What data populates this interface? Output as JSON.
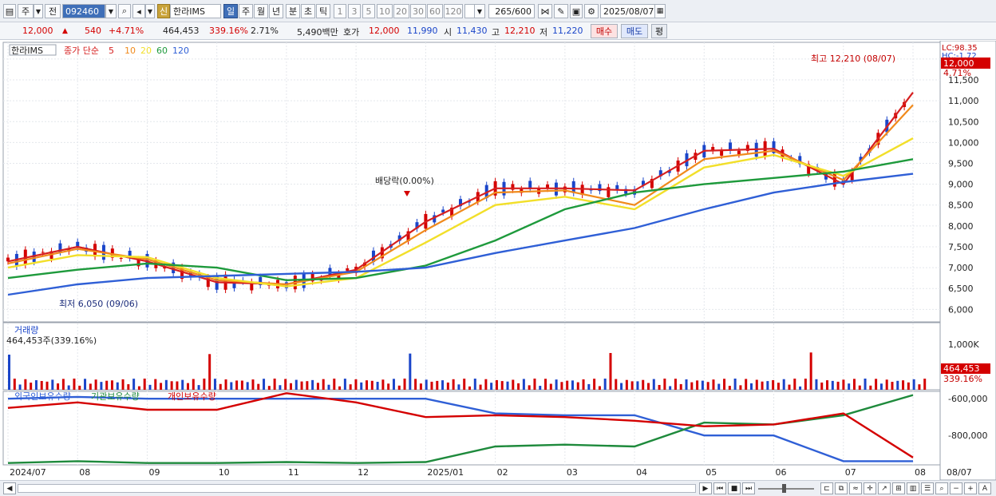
{
  "toolbar": {
    "period_label": "주",
    "prev_label": "전",
    "stock_code": "092460",
    "new_badge": "신",
    "stock_name": "한라IMS",
    "period_buttons": [
      "일",
      "주",
      "월",
      "년",
      "분",
      "초",
      "틱"
    ],
    "interval_buttons": [
      "1",
      "3",
      "5",
      "10",
      "20",
      "30",
      "60",
      "120"
    ],
    "count_value": "265",
    "count_total": "/600",
    "date_value": "2025/08/07"
  },
  "info": {
    "price": "12,000",
    "change": "540",
    "change_pct": "+4.71%",
    "volume": "464,453",
    "volume_ratio": "339.16%",
    "turnover": "2.71%",
    "amount": "5,490백만",
    "quote_label": "호가",
    "ask": "12,000",
    "bid": "11,990",
    "open_label": "시",
    "open": "11,430",
    "high_label": "고",
    "high": "12,210",
    "low_label": "저",
    "low": "11,220",
    "buy_label": "매수",
    "sell_label": "매도",
    "eval_label": "평"
  },
  "legend": {
    "name": "한라IMS",
    "ma_label": "종가 단순",
    "ma_periods": [
      "5",
      "10",
      "20",
      "60",
      "120"
    ]
  },
  "annotations": {
    "high": "최고 12,210 (08/07)",
    "low": "최저 6,050 (09/06)",
    "dividend": "배당락(0.00%)",
    "lc": "LC:98.35",
    "hc": "HC:-1.72",
    "price_tag": "12,000",
    "pct_tag": "4.71%"
  },
  "volume_panel": {
    "title": "거래량",
    "value_text": "464,453주(339.16%)",
    "axis_label": "1,000K",
    "tag_value": "464,453",
    "tag_pct": "339.16%"
  },
  "holding_panel": {
    "legend": [
      "외국인보유수량",
      "기관보유수량",
      "개인보유수량"
    ],
    "axis_labels": [
      "-600,000",
      "-800,000"
    ]
  },
  "colors": {
    "ma5": "#d61f1f",
    "ma10": "#f08a1c",
    "ma20": "#f2df2a",
    "ma60": "#1e9a3c",
    "ma120": "#2f5fd6",
    "up": "#d40000",
    "down": "#1a45c9"
  },
  "chart_data": {
    "type": "line",
    "title": "한라IMS",
    "x": [
      "2024/07",
      "08",
      "09",
      "10",
      "11",
      "12",
      "2025/01",
      "02",
      "03",
      "04",
      "05",
      "06",
      "07",
      "08"
    ],
    "right_axis_label": "08/07",
    "price_ticks": [
      12000,
      11500,
      11000,
      10500,
      10000,
      9500,
      9000,
      8500,
      8000,
      7500,
      7000,
      6500,
      6000
    ],
    "ylim": [
      5700,
      12400
    ],
    "series": [
      {
        "name": "5",
        "values": [
          7150,
          7500,
          7150,
          6650,
          6600,
          6950,
          8100,
          8900,
          8900,
          8850,
          9800,
          9850,
          9000,
          11200
        ]
      },
      {
        "name": "10",
        "values": [
          7100,
          7450,
          7200,
          6700,
          6600,
          6900,
          7900,
          8800,
          8850,
          8500,
          9600,
          9800,
          9100,
          10900
        ]
      },
      {
        "name": "20",
        "values": [
          7000,
          7300,
          7250,
          6750,
          6550,
          6750,
          7600,
          8500,
          8700,
          8400,
          9400,
          9700,
          9200,
          10100
        ]
      },
      {
        "name": "60",
        "values": [
          6750,
          6950,
          7100,
          7000,
          6700,
          6750,
          7050,
          7650,
          8400,
          8800,
          9000,
          9150,
          9300,
          9600
        ]
      },
      {
        "name": "120",
        "values": [
          6350,
          6600,
          6750,
          6800,
          6850,
          6900,
          7000,
          7350,
          7650,
          7950,
          8400,
          8800,
          9050,
          9250
        ]
      }
    ],
    "holdings": {
      "series": [
        {
          "name": "외국인보유수량",
          "values": [
            -600000,
            -590000,
            -600000,
            -600000,
            -600000,
            -600000,
            -600000,
            -680000,
            -690000,
            -690000,
            -800000,
            -800000,
            -940000,
            -940000
          ]
        },
        {
          "name": "기관보유수량",
          "values": [
            -950000,
            -940000,
            -950000,
            -950000,
            -945000,
            -950000,
            -945000,
            -860000,
            -850000,
            -860000,
            -730000,
            -740000,
            -690000,
            -580000
          ]
        },
        {
          "name": "개인보유수량",
          "values": [
            -650000,
            -620000,
            -660000,
            -660000,
            -570000,
            -620000,
            -700000,
            -690000,
            -700000,
            -720000,
            -750000,
            -740000,
            -680000,
            -920000
          ]
        }
      ]
    }
  }
}
